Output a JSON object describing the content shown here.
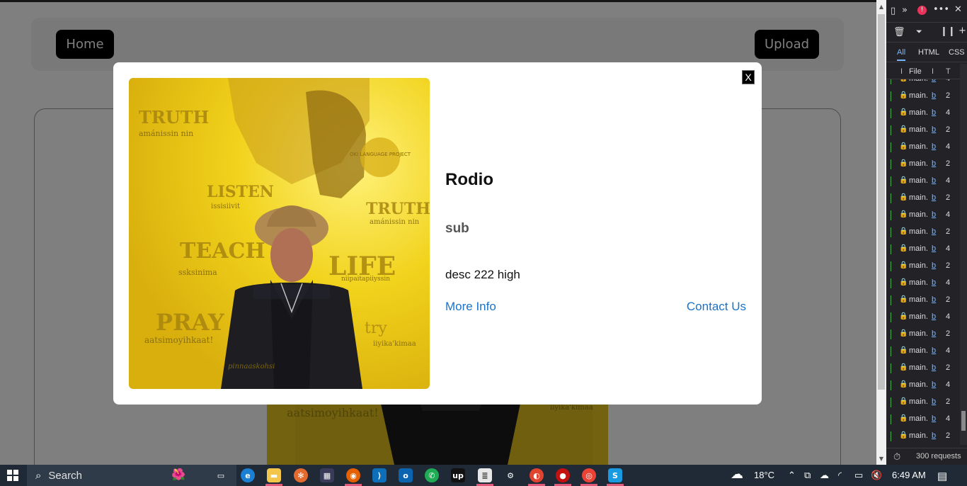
{
  "nav": {
    "home": "Home",
    "upload": "Upload"
  },
  "modal": {
    "close": "X",
    "title": "Rodio",
    "subtitle": "sub",
    "description": "desc 222 high",
    "more_info": "More Info",
    "contact": "Contact Us",
    "image_text": {
      "w1": "TRUTH",
      "w1b": "amánissin nin",
      "w2": "LISTEN",
      "w2b": "issisiivit",
      "w3": "TRUTH",
      "w3b": "amánissin nin",
      "w4": "TEACH",
      "w4b": "ssksinima",
      "w5": "LIFE",
      "w5b": "niipaitapiiyssin",
      "w6": "PRAY",
      "w6b": "aatsimoyihkaat!",
      "w7": "try",
      "w7b": "iiyika'kimaa",
      "seal": "OKI LANGUAGE PROJECT",
      "signature": "pinnaaskohsi"
    }
  },
  "devtools": {
    "tabs": [
      "All",
      "HTML",
      "CSS"
    ],
    "header_file": "File",
    "header_i": "I",
    "header_t": "T",
    "rows": [
      {
        "file": "main.",
        "b": "b",
        "n": "4"
      },
      {
        "file": "main.",
        "b": "b",
        "n": "2"
      },
      {
        "file": "main.",
        "b": "b",
        "n": "4"
      },
      {
        "file": "main.",
        "b": "b",
        "n": "2"
      },
      {
        "file": "main.",
        "b": "b",
        "n": "4"
      },
      {
        "file": "main.",
        "b": "b",
        "n": "2"
      },
      {
        "file": "main.",
        "b": "b",
        "n": "4"
      },
      {
        "file": "main.",
        "b": "b",
        "n": "2"
      },
      {
        "file": "main.",
        "b": "b",
        "n": "4"
      },
      {
        "file": "main.",
        "b": "b",
        "n": "2"
      },
      {
        "file": "main.",
        "b": "b",
        "n": "4"
      },
      {
        "file": "main.",
        "b": "b",
        "n": "2"
      },
      {
        "file": "main.",
        "b": "b",
        "n": "4"
      },
      {
        "file": "main.",
        "b": "b",
        "n": "2"
      },
      {
        "file": "main.",
        "b": "b",
        "n": "4"
      },
      {
        "file": "main.",
        "b": "b",
        "n": "2"
      },
      {
        "file": "main.",
        "b": "b",
        "n": "4"
      },
      {
        "file": "main.",
        "b": "b",
        "n": "2"
      },
      {
        "file": "main.",
        "b": "b",
        "n": "4"
      },
      {
        "file": "main.",
        "b": "b",
        "n": "2"
      },
      {
        "file": "main.",
        "b": "b",
        "n": "4"
      },
      {
        "file": "main.",
        "b": "b",
        "n": "2"
      }
    ],
    "requests": "300 requests"
  },
  "taskbar": {
    "search": "Search",
    "weather": "18°C",
    "time": "6:49 AM"
  },
  "colors": {
    "link": "#1a73c8",
    "overlay": "rgba(0,0,0,0.5)",
    "taskbar": "#1f2a36",
    "devtools_bg": "#232327"
  }
}
